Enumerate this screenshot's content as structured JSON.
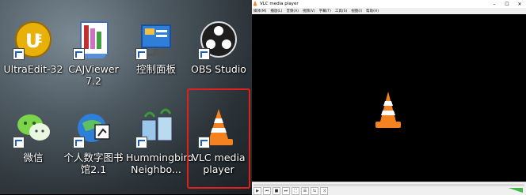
{
  "desktop": {
    "icons": [
      {
        "id": "ultraedit",
        "label": "UltraEdit-32"
      },
      {
        "id": "cajviewer",
        "label": "CAJViewer 7.2"
      },
      {
        "id": "control-panel",
        "label": "控制面板"
      },
      {
        "id": "obs",
        "label": "OBS Studio"
      },
      {
        "id": "wechat",
        "label": "微信"
      },
      {
        "id": "digital-library",
        "label": "个人数字图书馆2.1"
      },
      {
        "id": "hummingbird",
        "label": "Hummingbird Neighbo..."
      },
      {
        "id": "vlc",
        "label": "VLC media player"
      }
    ]
  },
  "vlc": {
    "title": "VLC media player",
    "menu": [
      "媒体(M)",
      "播放(L)",
      "音频(A)",
      "视频(V)",
      "字幕(T)",
      "工具(S)",
      "视图(I)",
      "帮助(H)"
    ],
    "window_buttons": [
      "–",
      "☐",
      "✕"
    ],
    "controls": [
      "▶",
      "⏮",
      "■",
      "⏭",
      "⛶",
      "☰",
      "⇆",
      "⤨"
    ]
  }
}
